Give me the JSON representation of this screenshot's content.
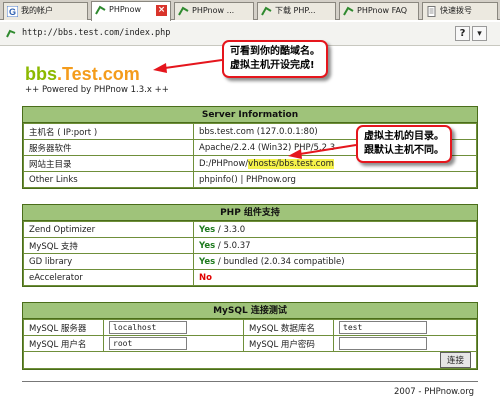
{
  "tabs": [
    {
      "label": "我的帐户",
      "icon": "g-icon"
    },
    {
      "label": "PHPnow",
      "icon": "phpnow-icon",
      "active": true
    },
    {
      "label": "PHPnow ...",
      "icon": "phpnow-icon"
    },
    {
      "label": "下载 PHP...",
      "icon": "phpnow-icon"
    },
    {
      "label": "PHPnow FAQ",
      "icon": "phpnow-icon"
    },
    {
      "label": "快速拨号",
      "icon": "page-icon"
    }
  ],
  "address": {
    "url": "http://bbs.test.com/index.php",
    "help_label": "?",
    "menu_label": "▾"
  },
  "logo": {
    "part1": "bbs",
    "part2": ".Test.com"
  },
  "powered": "++ Powered by PHPnow 1.3.x ++",
  "server": {
    "title": "Server Information",
    "rows": [
      {
        "key": "主机名 ( IP:port )",
        "value": "bbs.test.com (127.0.0.1:80)"
      },
      {
        "key": "服务器软件",
        "value": "Apache/2.2.4 (Win32) PHP/5.2.3"
      },
      {
        "key": "网站主目录",
        "value_prefix": "D:/PHPnow/",
        "value_highlight": "vhosts/bbs.test.com"
      },
      {
        "key": "Other Links",
        "value": "phpinfo() | PHPnow.org"
      }
    ]
  },
  "php": {
    "title": "PHP 组件支持",
    "rows": [
      {
        "key": "Zend Optimizer",
        "status": "Yes",
        "detail": " / 3.3.0"
      },
      {
        "key": "MySQL 支持",
        "status": "Yes",
        "detail": " / 5.0.37"
      },
      {
        "key": "GD library",
        "status": "Yes",
        "detail": " / bundled (2.0.34 compatible)"
      },
      {
        "key": "eAccelerator",
        "status": "No",
        "detail": ""
      }
    ]
  },
  "mysql": {
    "title": "MySQL 连接测试",
    "server_label": "MySQL 服务器",
    "server_value": "localhost",
    "db_label": "MySQL 数据库名",
    "db_value": "test",
    "user_label": "MySQL 用户名",
    "user_value": "root",
    "pass_label": "MySQL 用户密码",
    "pass_value": "",
    "submit_label": "连接"
  },
  "footer": "2007 - PHPnow.org",
  "callouts": {
    "domain": [
      "可看到你的酷域名。",
      "虚拟主机开设完成!"
    ],
    "vhost": [
      "虚拟主机的目录。",
      "跟默认主机不同。"
    ]
  },
  "colors": {
    "accent_green": "#8cb900",
    "accent_orange": "#f49c1c",
    "section_header": "#9fc37a",
    "callout_border": "#e5161d",
    "highlight": "#f5f24a"
  }
}
